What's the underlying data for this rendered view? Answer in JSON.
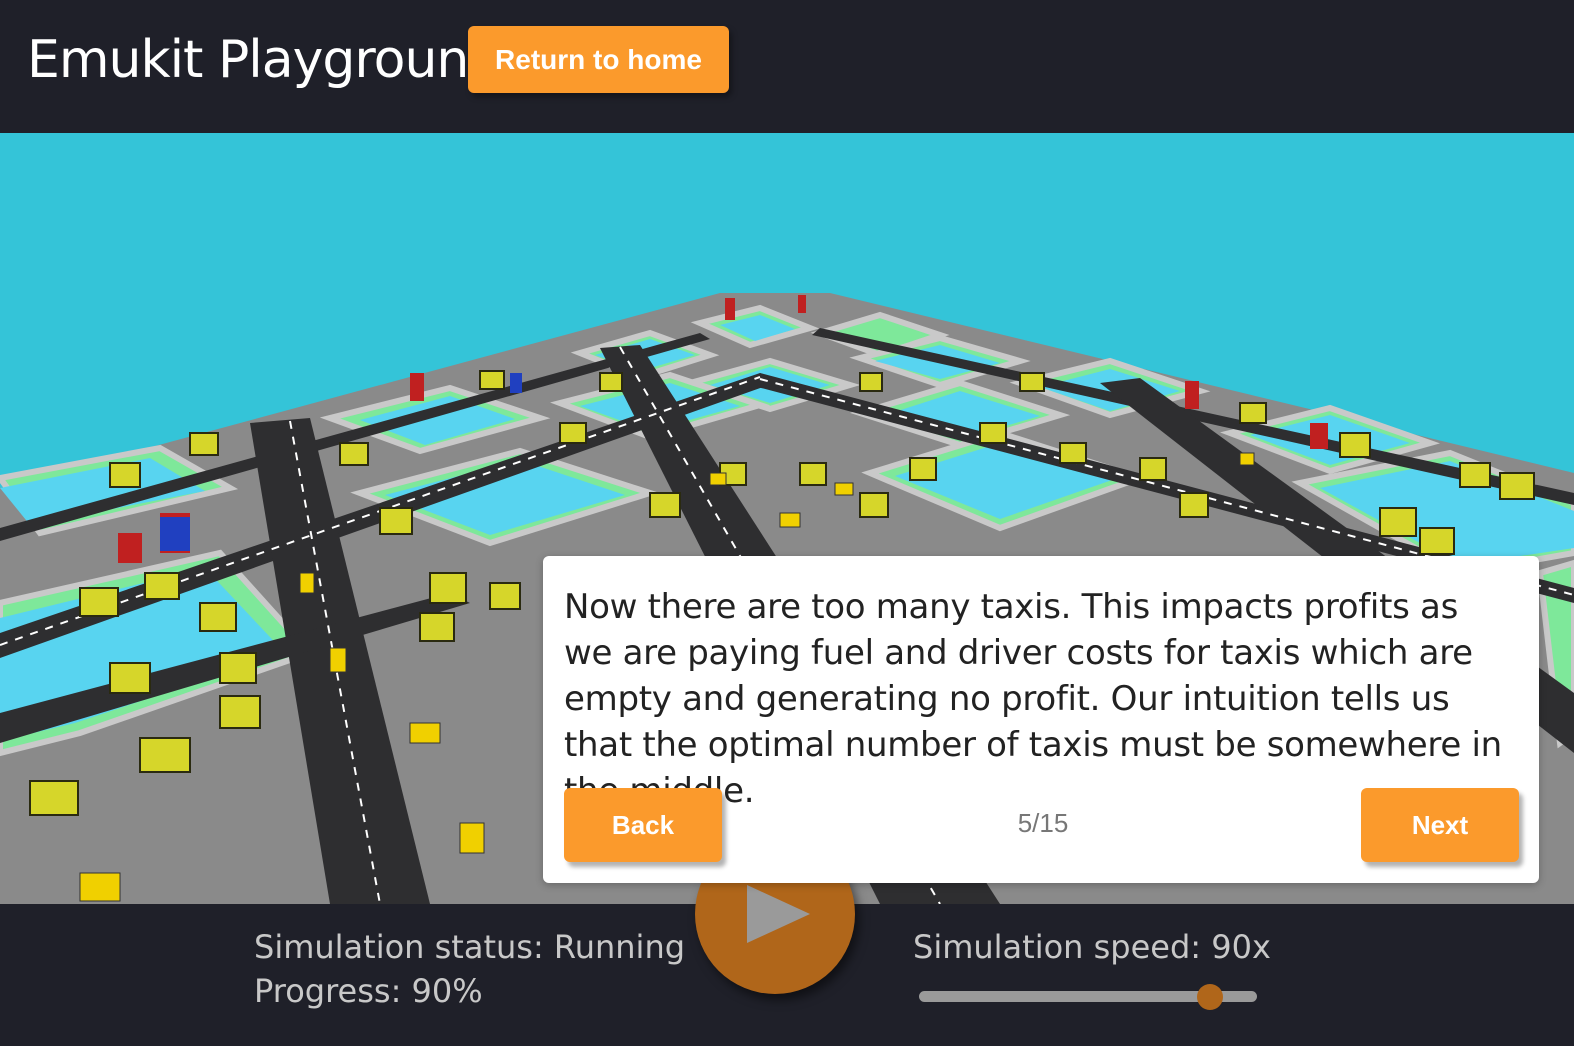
{
  "header": {
    "title": "Emukit Playground",
    "home_button": "Return to home"
  },
  "tutorial": {
    "text": "Now there are too many taxis. This impacts profits as we are paying fuel and driver costs for taxis which are empty and generating no profit. Our intuition tells us that the optimal number of taxis must be somewhere in the middle.",
    "back_label": "Back",
    "next_label": "Next",
    "page": "5/15"
  },
  "simulation": {
    "status": "Simulation status: Running",
    "progress": "Progress: 90%",
    "speed": "Simulation speed: 90x",
    "speed_slider_fraction": 0.86,
    "play_icon": "play-icon"
  },
  "colors": {
    "accent": "#fb9a2c",
    "header_bg": "#1f2029",
    "sky": "#34c4d8",
    "play_button": "#b0661a"
  }
}
